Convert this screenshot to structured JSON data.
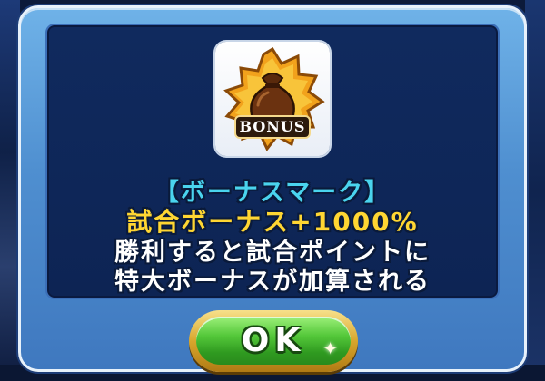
{
  "dialog": {
    "icon": {
      "name": "bonus-bag-icon",
      "badge_text": "BONUS"
    },
    "title": "【ボーナスマーク】",
    "bonus_line": "試合ボーナス+1000%",
    "description_line1": "勝利すると試合ポイントに",
    "description_line2": "特大ボーナスが加算される",
    "ok_button": "OK"
  },
  "colors": {
    "title": "#4ad4ee",
    "bonus": "#ffd632",
    "panel": "#0d2454",
    "frame": "#4f8fd0",
    "ok_green": "#54c83a",
    "ok_gold": "#d8a62c"
  }
}
